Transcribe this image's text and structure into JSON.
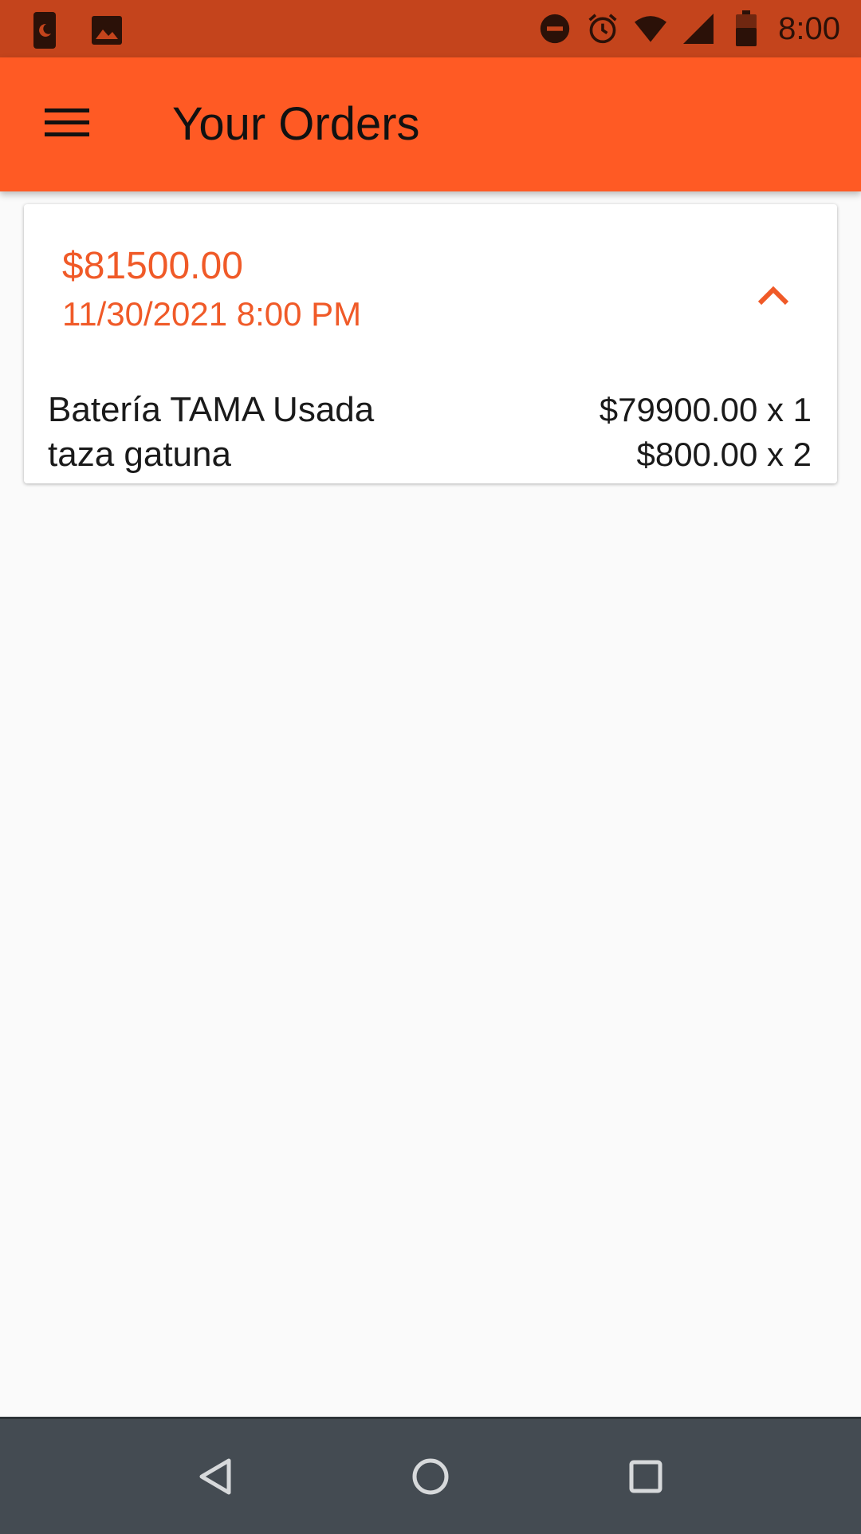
{
  "status_bar": {
    "time": "8:00",
    "left_icons": [
      "phone-night-icon",
      "image-icon"
    ],
    "right_icons": [
      "do-not-disturb-icon",
      "alarm-icon",
      "wifi-icon",
      "signal-icon",
      "battery-icon"
    ]
  },
  "app_bar": {
    "title": "Your Orders",
    "menu_icon": "menu-icon"
  },
  "order": {
    "total": "$81500.00",
    "date": "11/30/2021 8:00 PM",
    "expanded": true,
    "items": [
      {
        "name": "Batería TAMA Usada",
        "price_qty": "$79900.00 x 1"
      },
      {
        "name": "taza gatuna",
        "price_qty": "$800.00 x 2"
      }
    ]
  },
  "nav_bar": {
    "buttons": [
      "back-icon",
      "home-icon",
      "recents-icon"
    ]
  },
  "colors": {
    "accent": "#ff5a24",
    "status_bar": "#c4441c",
    "order_text": "#f05a28",
    "nav_bar": "#444b52"
  }
}
